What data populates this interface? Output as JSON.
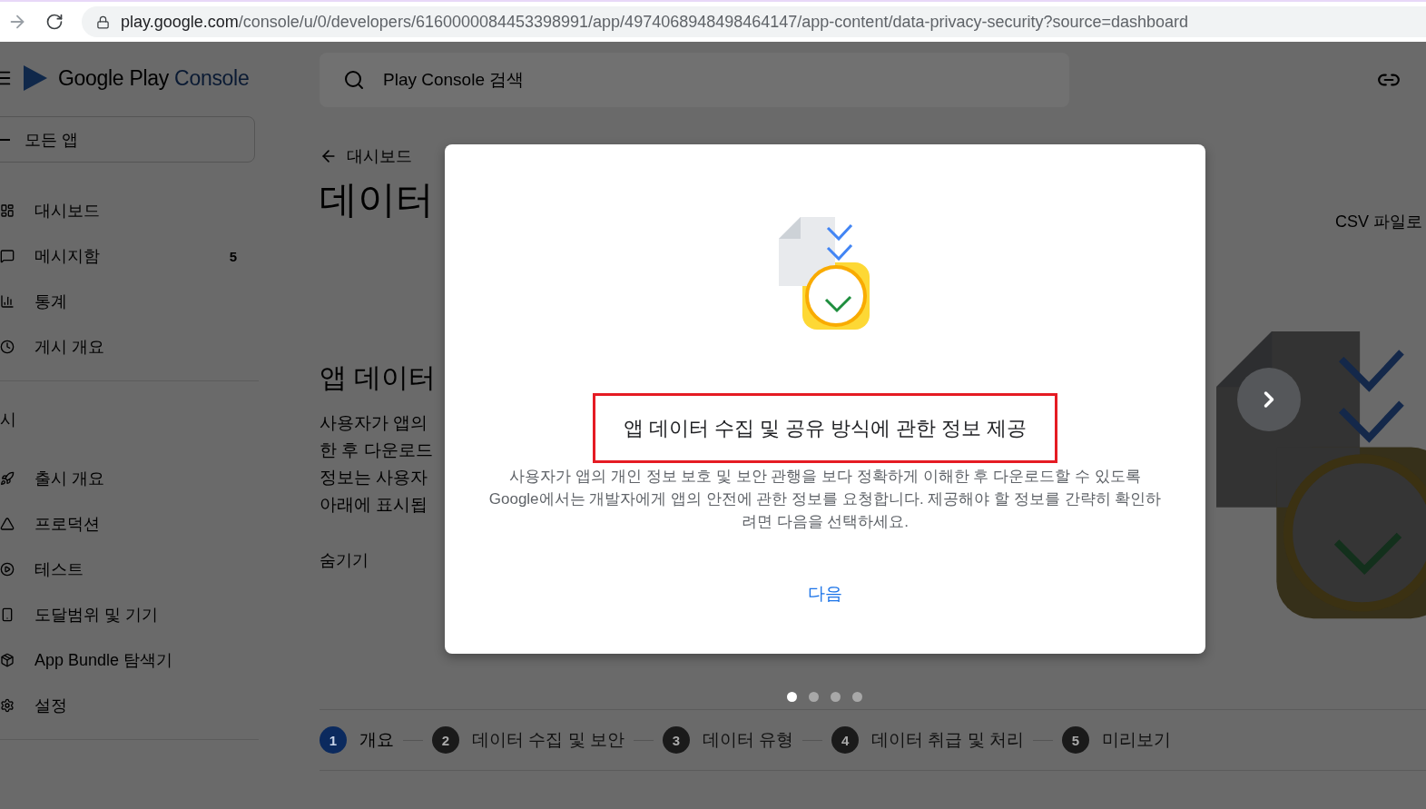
{
  "browser": {
    "url_host": "play.google.com",
    "url_path": "/console/u/0/developers/6160000084453398991/app/4974068948498464147/app-content/data-privacy-security?source=dashboard"
  },
  "header": {
    "logo_text": "Google Play",
    "logo_accent": "Console",
    "search": {
      "placeholder": "Play Console 검색"
    }
  },
  "sidebar": {
    "app_selector": "모든 앱",
    "groups": [
      {
        "items": [
          {
            "label": "대시보드"
          },
          {
            "label": "메시지함",
            "badge": "5"
          },
          {
            "label": "통계"
          },
          {
            "label": "게시 개요"
          }
        ]
      },
      {
        "heading": "시",
        "items": [
          {
            "label": "출시 개요"
          },
          {
            "label": "프로덕션"
          },
          {
            "label": "테스트"
          },
          {
            "label": "도달범위 및 기기"
          },
          {
            "label": "App Bundle 탐색기"
          },
          {
            "label": "설정"
          }
        ]
      }
    ]
  },
  "main": {
    "back_link": "대시보드",
    "title": "데이터",
    "export_link": "CSV 파일로",
    "section_title": "앱 데이터",
    "paragraph_lines": [
      "사용자가 앱의",
      "한 후 다운로드",
      "정보는 사용자",
      "아래에 표시됩"
    ],
    "hide_link": "숨기기",
    "carousel_dots": [
      {
        "selected": true
      },
      {
        "selected": false
      },
      {
        "selected": false
      },
      {
        "selected": false
      }
    ],
    "steps": [
      {
        "number": "1",
        "label": "개요",
        "selected": true
      },
      {
        "number": "2",
        "label": "데이터 수집 및 보안",
        "selected": false
      },
      {
        "number": "3",
        "label": "데이터 유형",
        "selected": false
      },
      {
        "number": "4",
        "label": "데이터 취급 및 처리",
        "selected": false
      },
      {
        "number": "5",
        "label": "미리보기",
        "selected": false
      }
    ]
  },
  "dialog": {
    "title": "앱 데이터 수집 및 공유 방식에 관한 정보 제공",
    "title_highlighted": true,
    "body": "사용자가 앱의 개인 정보 보호 및 보안 관행을 보다 정확하게 이해한 후 다운로드할 수 있도록 Google에서는 개발자에게 앱의 안전에 관한 정보를 요청합니다. 제공해야 할 정보를 간략히 확인하려면 다음을 선택하세요.",
    "next_link": "다음"
  }
}
